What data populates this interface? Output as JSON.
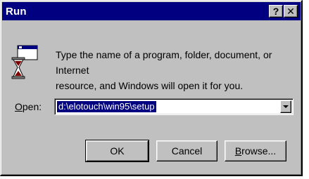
{
  "window": {
    "title": "Run"
  },
  "titlebar": {
    "help_label": "?",
    "close_label": "✕"
  },
  "dialog": {
    "description_line1": "Type the name of a program, folder, document, or Internet",
    "description_line2": "resource, and Windows will open it for you.",
    "open_label_accel": "O",
    "open_label_rest": "pen:",
    "open_value": "d:\\elotouch\\win95\\setup"
  },
  "buttons": {
    "ok": "OK",
    "cancel": "Cancel",
    "browse_accel": "B",
    "browse_rest": "rowse..."
  },
  "colors": {
    "titlebar": "#000080",
    "face": "#c0c0c0",
    "selection": "#000080"
  },
  "icons": [
    "run-program-icon",
    "help-icon",
    "close-icon",
    "dropdown-arrow-icon"
  ]
}
